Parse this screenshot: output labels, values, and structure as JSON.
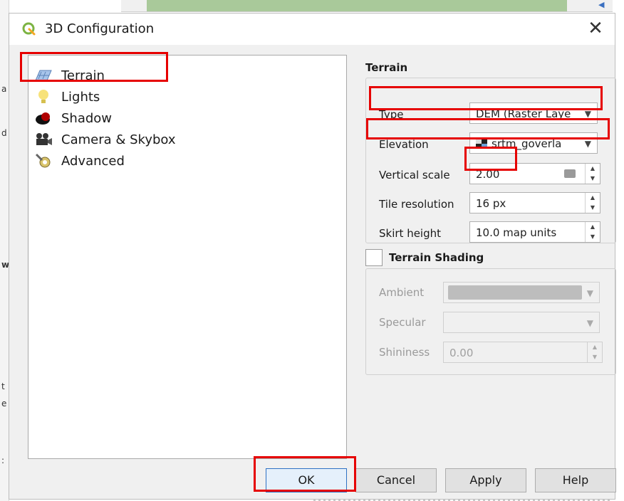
{
  "dialog": {
    "title": "3D Configuration",
    "close_glyph": "✕"
  },
  "nav": {
    "items": [
      {
        "label": "Terrain",
        "icon": "terrain-icon"
      },
      {
        "label": "Lights",
        "icon": "lightbulb-icon"
      },
      {
        "label": "Shadow",
        "icon": "shadow-icon"
      },
      {
        "label": "Camera & Skybox",
        "icon": "camera-icon"
      },
      {
        "label": "Advanced",
        "icon": "advanced-icon"
      }
    ],
    "selected": "Terrain"
  },
  "terrain": {
    "section_title": "Terrain",
    "type_label": "Type",
    "type_value": "DEM (Raster Laye",
    "elevation_label": "Elevation",
    "elevation_value": "srtm_goverla",
    "vertical_scale_label": "Vertical scale",
    "vertical_scale_value": "2.00",
    "tile_resolution_label": "Tile resolution",
    "tile_resolution_value": "16 px",
    "skirt_height_label": "Skirt height",
    "skirt_height_value": "10.0 map units"
  },
  "shading": {
    "section_title": "Terrain Shading",
    "checked": false,
    "ambient_label": "Ambient",
    "specular_label": "Specular",
    "shininess_label": "Shininess",
    "shininess_value": "0.00"
  },
  "buttons": {
    "ok": "OK",
    "cancel": "Cancel",
    "apply": "Apply",
    "help": "Help"
  },
  "colors": {
    "highlight": "#e60000",
    "accent": "#2f72c4"
  }
}
